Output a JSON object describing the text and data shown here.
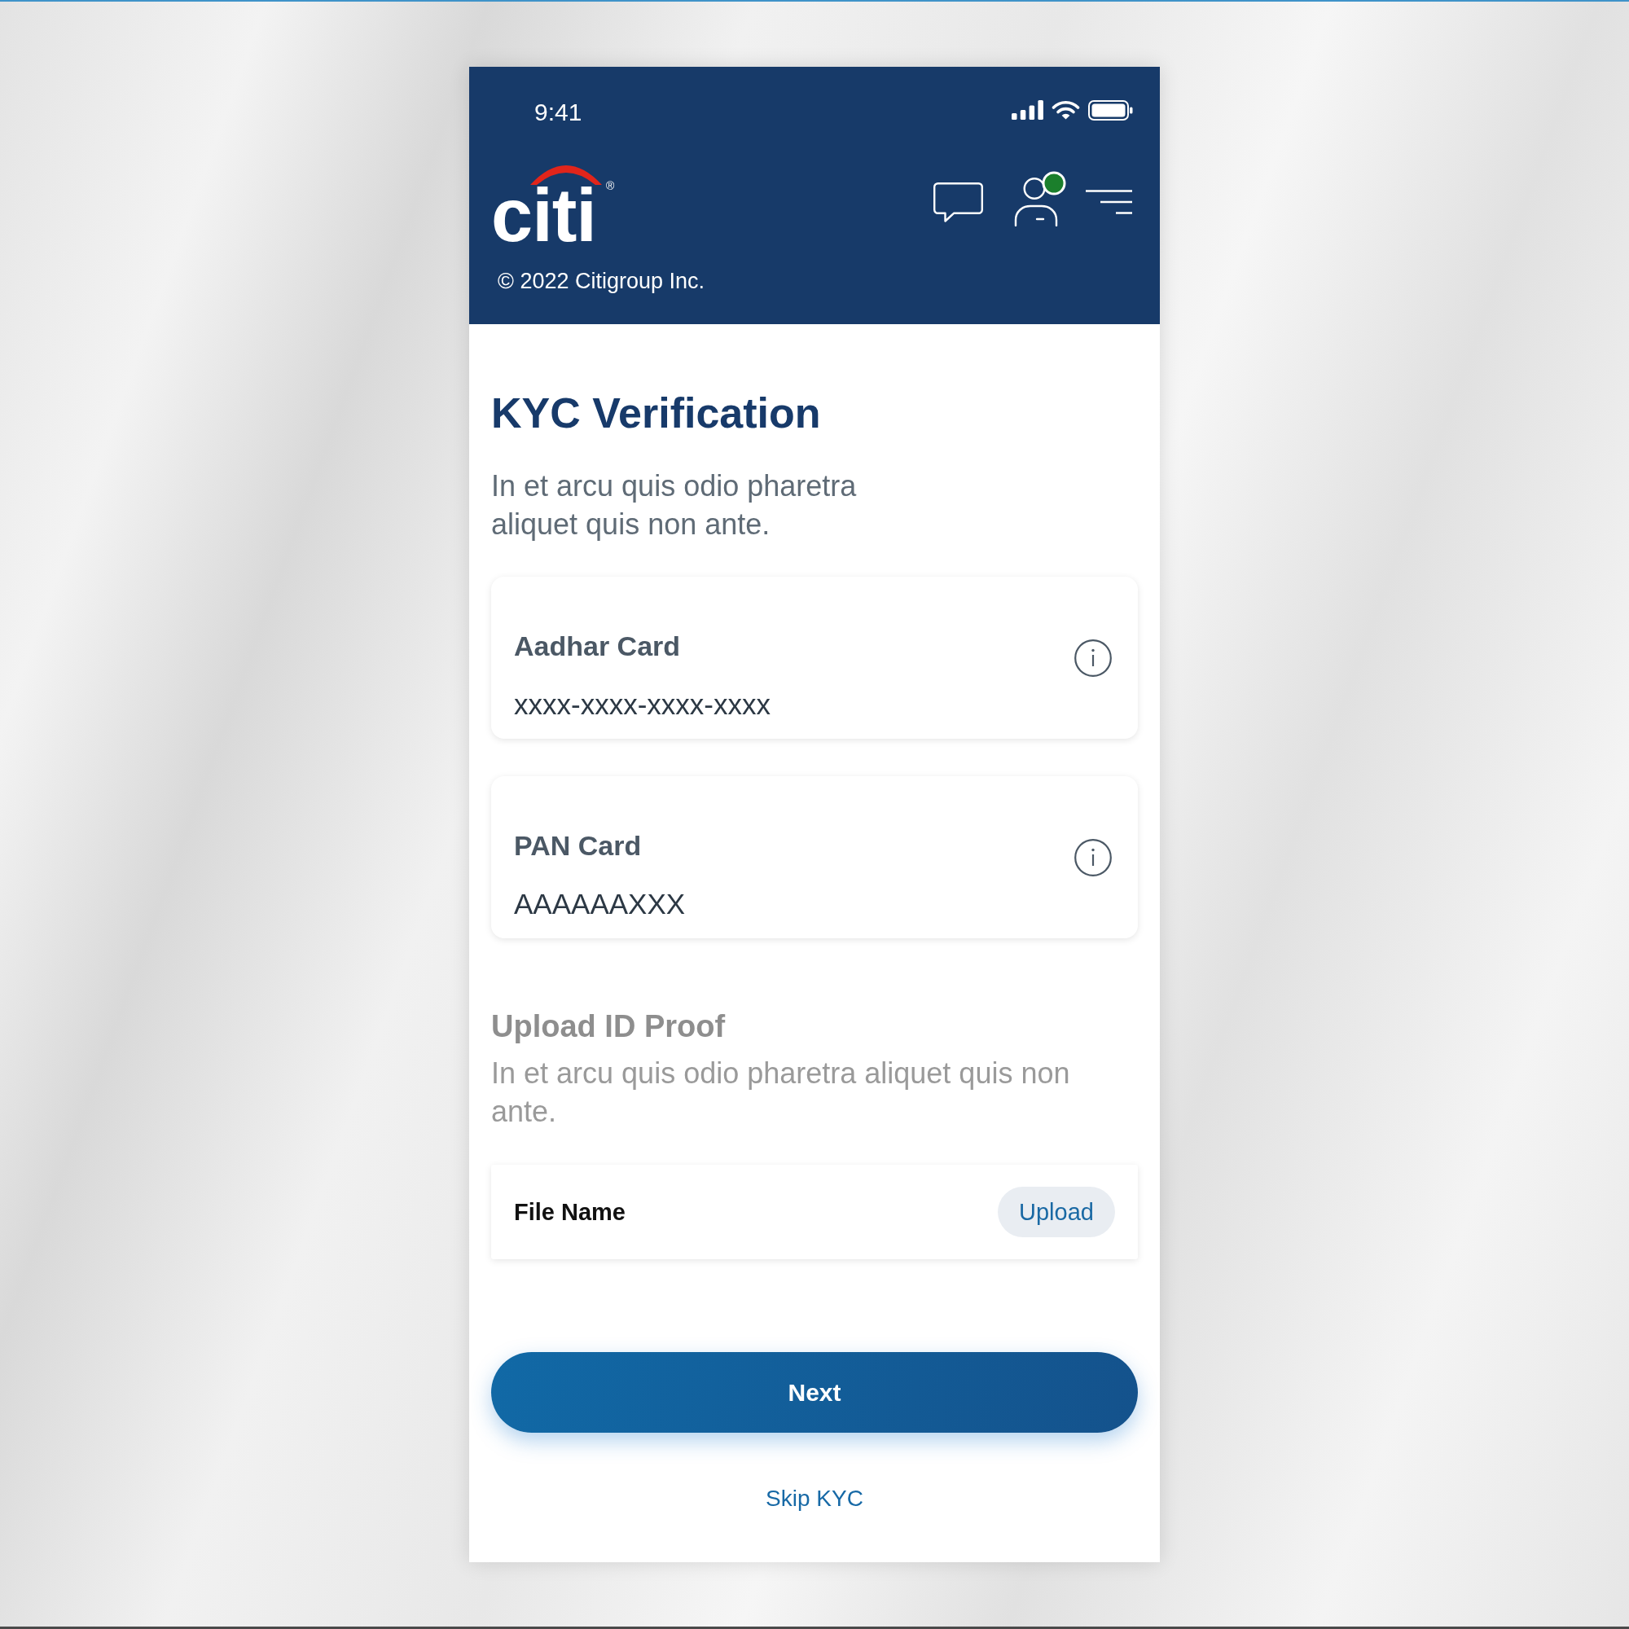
{
  "status_bar": {
    "time": "9:41"
  },
  "header": {
    "logo": {
      "text": "citi",
      "mark": "®"
    },
    "profile": {
      "notification": true
    },
    "copyright": "© 2022 Citigroup Inc."
  },
  "kyc": {
    "title": "KYC Verification",
    "description": "In et arcu quis odio pharetra aliquet quis non ante.",
    "fields": [
      {
        "label": "Aadhar Card",
        "value": "xxxx-xxxx-xxxx-xxxx"
      },
      {
        "label": "PAN Card",
        "value": "AAAAAAXXX"
      }
    ]
  },
  "upload": {
    "title": "Upload ID Proof",
    "description": "In et arcu quis odio pharetra aliquet quis non ante.",
    "file_name": "File Name",
    "button": "Upload"
  },
  "actions": {
    "primary": "Next",
    "secondary": "Skip KYC"
  }
}
